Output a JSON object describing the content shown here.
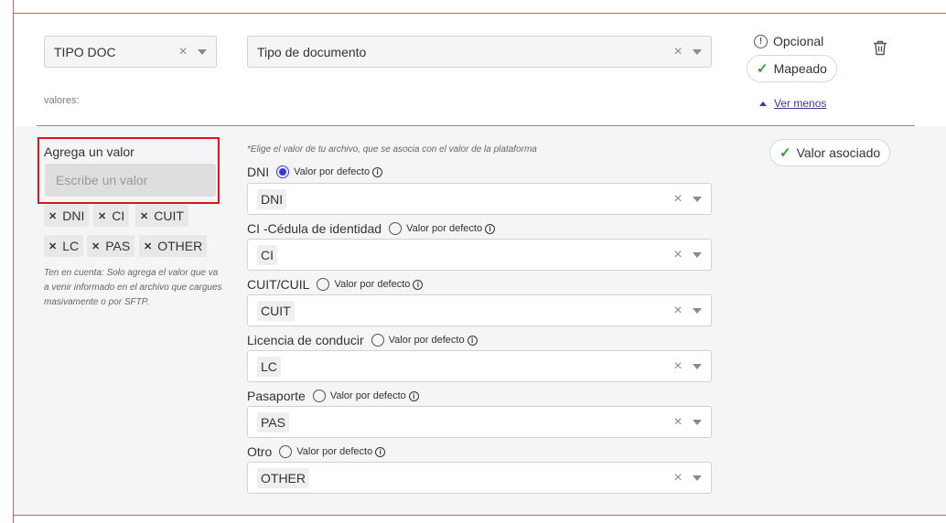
{
  "mapping": {
    "field_select": {
      "value": "TIPO DOC"
    },
    "platform_select": {
      "value": "Tipo de documento"
    },
    "optional_label": "Opcional",
    "mapped_label": "Mapeado",
    "values_label": "valores:",
    "see_less_label": "Ver menos"
  },
  "add_value": {
    "label": "Agrega un valor",
    "placeholder": "Escribe un valor",
    "tags": [
      "DNI",
      "CI",
      "CUIT",
      "LC",
      "PAS",
      "OTHER"
    ],
    "note": "Ten en cuenta: Solo agrega el valor que va a venir informado en el archivo que cargues masivamente o por SFTP."
  },
  "associations": {
    "instruction": "*Elige el valor de tu archivo, que se asocia con el valor de la plataforma",
    "default_label": "Valor por defecto",
    "associated_label": "Valor asociado",
    "rows": [
      {
        "label": "DNI",
        "value": "DNI",
        "default_selected": true
      },
      {
        "label": "CI -Cédula de identidad",
        "value": "CI",
        "default_selected": false
      },
      {
        "label": "CUIT/CUIL",
        "value": "CUIT",
        "default_selected": false
      },
      {
        "label": "Licencia de conducir",
        "value": "LC",
        "default_selected": false
      },
      {
        "label": "Pasaporte",
        "value": "PAS",
        "default_selected": false
      },
      {
        "label": "Otro",
        "value": "OTHER",
        "default_selected": false
      }
    ]
  },
  "icons": {
    "clear": "close-icon",
    "caret": "chevron-down-icon",
    "delete": "trash-icon",
    "check": "check-icon",
    "info": "info-icon",
    "optional": "exclamation-circle-icon"
  },
  "colors": {
    "accent": "#3b3ad6",
    "highlight": "#e0161b",
    "success": "#2e9b3a"
  }
}
